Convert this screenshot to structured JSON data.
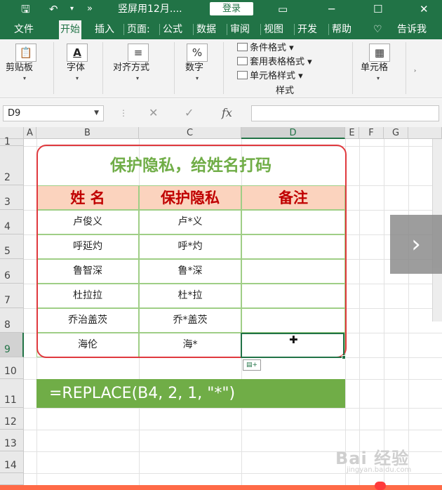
{
  "titlebar": {
    "save_icon": "🖫",
    "undo_icon": "↶",
    "undo_dropdown": "▾",
    "more_icon": "»",
    "title": "竖屏用12月....",
    "login_label": "登录",
    "layout_icon": "▭",
    "minimize_icon": "─",
    "maximize_icon": "☐",
    "close_icon": "✕"
  },
  "tabs": [
    "文件",
    "开始",
    "插入",
    "页面:",
    "公式",
    "数据",
    "审阅",
    "视图",
    "开发",
    "帮助"
  ],
  "tell_me": {
    "icon": "♡",
    "label": "告诉我"
  },
  "ribbon": {
    "clipboard": "剪贴板",
    "font": "字体",
    "alignment": "对齐方式",
    "number": "数字",
    "number_icon": "%",
    "conditional_format": "条件格式",
    "table_format": "套用表格格式",
    "cell_style": "单元格样式",
    "styles": "样式",
    "cells": "单元格"
  },
  "formula_bar": {
    "name_box": "D9",
    "cancel_icon": "✕",
    "enter_icon": "✓",
    "fx_icon": "fx",
    "value": ""
  },
  "columns": [
    "A",
    "B",
    "C",
    "D",
    "E",
    "F",
    "G"
  ],
  "rows": [
    "1",
    "2",
    "3",
    "4",
    "5",
    "6",
    "7",
    "8",
    "9",
    "10",
    "11",
    "12",
    "13",
    "14"
  ],
  "table": {
    "title": "保护隐私，给姓名打码",
    "headers": [
      "姓 名",
      "保护隐私",
      "备注"
    ],
    "rows": [
      [
        "卢俊义",
        "卢*义",
        ""
      ],
      [
        "呼延灼",
        "呼*灼",
        ""
      ],
      [
        "鲁智深",
        "鲁*深",
        ""
      ],
      [
        "杜拉拉",
        "杜*拉",
        ""
      ],
      [
        "乔治盖茨",
        "乔*盖茨",
        ""
      ],
      [
        "海伦",
        "海*",
        ""
      ]
    ]
  },
  "formula_banner": "=REPLACE(B4, 2, 1, \"*\")",
  "overlay": {
    "next_icon": "›",
    "watermark": "Bai 经验",
    "watermark_sub": "jingyan.baidu.com"
  }
}
